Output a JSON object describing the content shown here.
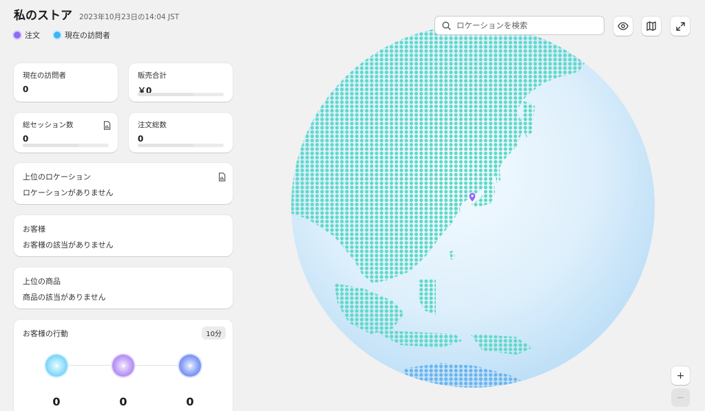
{
  "header": {
    "title": "私のストア",
    "timestamp": "2023年10月23日の14:04 JST",
    "legend": [
      {
        "label": "注文",
        "color": "#8c6cf2"
      },
      {
        "label": "現在の訪問者",
        "color": "#3bb6f5"
      }
    ]
  },
  "metrics": {
    "visitors": {
      "label": "現在の訪問者",
      "value": "0"
    },
    "sales": {
      "label": "販売合計",
      "value": "￥0",
      "progress": 0.65
    },
    "sessions": {
      "label": "総セッション数",
      "value": "0",
      "progress": 0.65,
      "icon": "report-icon"
    },
    "orders": {
      "label": "注文総数",
      "value": "0",
      "progress": 0.65
    }
  },
  "locations": {
    "title": "上位のロケーション",
    "empty": "ロケーションがありません",
    "icon": "report-icon"
  },
  "customers": {
    "title": "お客様",
    "empty": "お客様の該当がありません"
  },
  "products": {
    "title": "上位の商品",
    "empty": "商品の該当がありません"
  },
  "behavior": {
    "title": "お客様の行動",
    "badge": "10分",
    "steps": [
      {
        "value": "0",
        "color": "#56c2f0"
      },
      {
        "value": "0",
        "color": "#a073f0"
      },
      {
        "value": "0",
        "color": "#4f6ef0"
      }
    ]
  },
  "search": {
    "placeholder": "ロケーションを検索"
  },
  "toolbar": {
    "icons": [
      "eye-icon",
      "map-icon",
      "expand-icon"
    ]
  },
  "zoom": {
    "in_label": "+",
    "out_label": "−"
  },
  "colors": {
    "land": "#5fd9c8",
    "land_south": "#6ab4ee",
    "pin": "#8c6cf2",
    "globe": "#d7eefb"
  }
}
